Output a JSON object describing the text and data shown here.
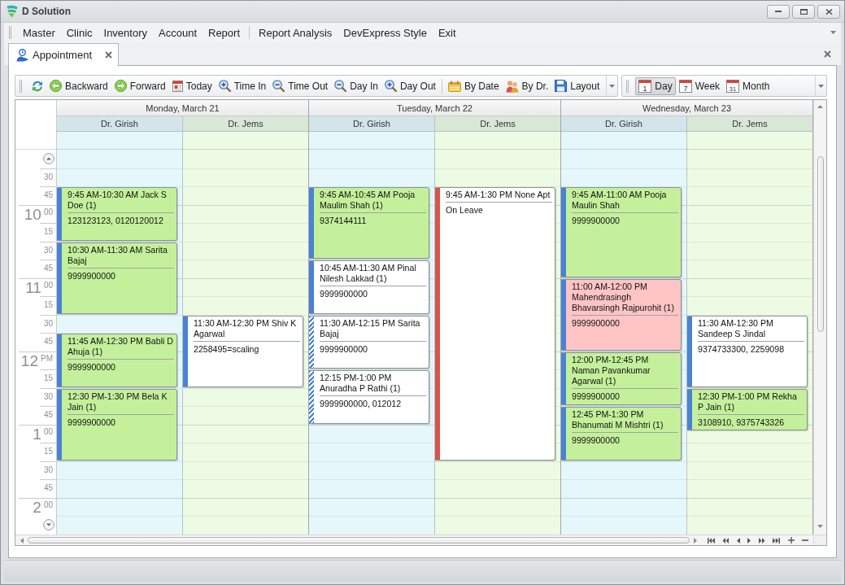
{
  "window": {
    "title": "D Solution"
  },
  "menu": [
    {
      "items": [
        "Master",
        "Clinic",
        "Inventory",
        "Account",
        "Report"
      ]
    },
    {
      "items": [
        "Report Analysis",
        "DevExpress Style",
        "Exit"
      ]
    }
  ],
  "tabs": [
    {
      "label": "Appointment",
      "selected": true
    }
  ],
  "toolbar": {
    "groups": [
      [
        {
          "kind": "refresh"
        },
        {
          "kind": "backward",
          "label": "Backward"
        },
        {
          "kind": "forward",
          "label": "Forward"
        },
        {
          "kind": "today",
          "label": "Today"
        },
        {
          "kind": "zoom_in",
          "label": "Time In"
        },
        {
          "kind": "zoom_out",
          "label": "Time Out"
        },
        {
          "kind": "zoom_out",
          "label": "Day In"
        },
        {
          "kind": "zoom_in",
          "label": "Day Out"
        }
      ],
      [
        {
          "kind": "by_date",
          "label": "By Date"
        },
        {
          "kind": "by_doctor",
          "label": "By Dr."
        },
        {
          "kind": "layout",
          "label": "Layout"
        }
      ]
    ]
  },
  "view_toolbar": [
    {
      "label": "Day",
      "icon_text": "1",
      "selected": true
    },
    {
      "label": "Week",
      "icon_text": "7",
      "selected": false
    },
    {
      "label": "Month",
      "icon_text": "31",
      "selected": false
    }
  ],
  "calendar": {
    "time_ruler": [
      {
        "kind": "scroll_up"
      },
      {
        "kind": "minute",
        "label": "30"
      },
      {
        "kind": "minute",
        "label": "45"
      },
      {
        "kind": "hour",
        "hour": "10",
        "label": "00"
      },
      {
        "kind": "minute",
        "label": "15"
      },
      {
        "kind": "minute",
        "label": "30"
      },
      {
        "kind": "minute",
        "label": "45"
      },
      {
        "kind": "hour",
        "hour": "11",
        "label": "00"
      },
      {
        "kind": "minute",
        "label": "15"
      },
      {
        "kind": "minute",
        "label": "30"
      },
      {
        "kind": "minute",
        "label": "45"
      },
      {
        "kind": "hour",
        "hour": "12",
        "label": "PM"
      },
      {
        "kind": "minute",
        "label": "15"
      },
      {
        "kind": "minute",
        "label": "30"
      },
      {
        "kind": "minute",
        "label": "45"
      },
      {
        "kind": "hour",
        "hour": "1",
        "label": "00"
      },
      {
        "kind": "minute",
        "label": "15"
      },
      {
        "kind": "minute",
        "label": "30"
      },
      {
        "kind": "minute",
        "label": "45"
      },
      {
        "kind": "hour",
        "hour": "2",
        "label": "00"
      },
      {
        "kind": "scroll_down"
      }
    ],
    "days": [
      {
        "date": "Monday, March 21",
        "resources": [
          {
            "name": "Dr. Girish",
            "color": "#e6f7fc",
            "appointments": [
              {
                "title": "9:45 AM-10:30 AM Jack S Doe (1)",
                "note": "123123123, 0120120012",
                "color": "#c4f09b",
                "kind": "busy"
              },
              {
                "title": "10:30 AM-11:30 AM Sarita Bajaj",
                "note": "9999900000",
                "color": "#c4f09b",
                "kind": "busy"
              },
              {
                "title": "11:45 AM-12:30 PM Babli D Ahuja (1)",
                "note": "9999900000",
                "color": "#c4f09b",
                "kind": "busy"
              },
              {
                "title": "12:30 PM-1:30 PM Bela K Jain (1)",
                "note": "9999900000",
                "color": "#c4f09b",
                "kind": "busy"
              }
            ]
          },
          {
            "name": "Dr. Jems",
            "color": "#eefbe4",
            "appointments": [
              {
                "title": "11:30 AM-12:30 PM Shiv K Agarwal",
                "note": "2258495=scaling",
                "color": "#ffffff",
                "kind": "busy"
              }
            ]
          }
        ]
      },
      {
        "date": "Tuesday, March 22",
        "resources": [
          {
            "name": "Dr. Girish",
            "color": "#e6f7fc",
            "appointments": [
              {
                "title": "9:45 AM-10:45 AM Pooja Maulim Shah (1)",
                "note": "9374144111",
                "color": "#c4f09b",
                "kind": "busy"
              },
              {
                "title": "10:45 AM-11:30 AM Pinal Nilesh Lakkad (1)",
                "note": "9999900000",
                "color": "#ffffff",
                "kind": "busy"
              },
              {
                "title": "11:30 AM-12:15 PM Sarita Bajaj",
                "note": "9999900000",
                "color": "#ffffff",
                "kind": "tentative"
              },
              {
                "title": "12:15 PM-1:00 PM Anuradha P Rathi (1)",
                "note": "9999900000, 012012",
                "color": "#ffffff",
                "kind": "tentative"
              }
            ]
          },
          {
            "name": "Dr. Jems",
            "color": "#eefbe4",
            "appointments": [
              {
                "title": "9:45 AM-1:30 PM None Apt",
                "note": "On Leave",
                "color": "#ffffff",
                "kind": "away"
              }
            ]
          }
        ]
      },
      {
        "date": "Wednesday, March 23",
        "resources": [
          {
            "name": "Dr. Girish",
            "color": "#e6f7fc",
            "appointments": [
              {
                "title": "9:45 AM-11:00 AM Pooja Maulin Shah",
                "note": "9999900000",
                "color": "#c4f09b",
                "kind": "busy"
              },
              {
                "title": "11:00 AM-12:00 PM Mahendrasingh Bhavarsingh Rajpurohit (1)",
                "note": "9999900000",
                "color": "#ffc4c4",
                "kind": "busy"
              },
              {
                "title": "12:00 PM-12:45 PM Naman Pavankumar Agarwal (1)",
                "note": "9999900000",
                "color": "#c4f09b",
                "kind": "busy"
              },
              {
                "title": "12:45 PM-1:30 PM Bhanumati M Mishtri (1)",
                "note": "9999900000",
                "color": "#c4f09b",
                "kind": "busy"
              }
            ]
          },
          {
            "name": "Dr. Jems",
            "color": "#eefbe4",
            "appointments": [
              {
                "title": "11:30 AM-12:30 PM Sandeep S Jindal",
                "note": "9374733300, 2259098",
                "color": "#ffffff",
                "kind": "busy"
              },
              {
                "title": "12:30 PM-1:00 PM Rekha P Jain (1)",
                "note": "3108910, 9375743326",
                "color": "#c4f09b",
                "kind": "busy"
              }
            ]
          }
        ]
      }
    ]
  }
}
